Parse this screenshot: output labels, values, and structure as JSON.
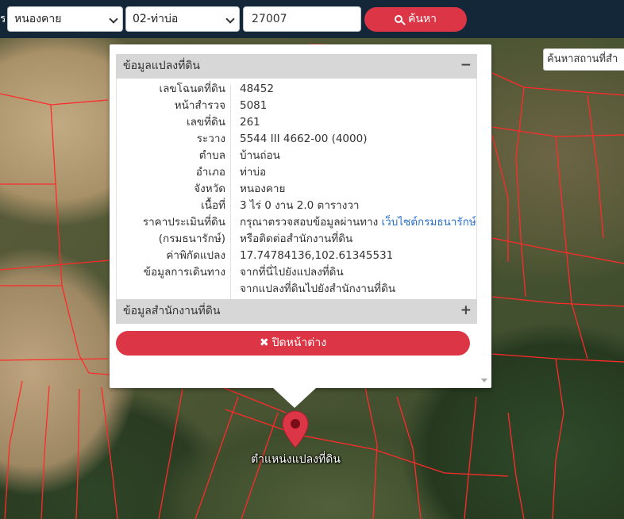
{
  "topbar": {
    "clipped_label": "ร",
    "province_select": "หนองคาย",
    "district_select": "02-ท่าบ่อ",
    "parcel_number_value": "27007",
    "search_button_label": "ค้นหา"
  },
  "map": {
    "land_office_search_placeholder": "ค้นหาสถานที่สำ",
    "marker_label": "ตำแหน่งแปลงที่ดิน",
    "parcel_line_color": "#ff2a2a",
    "marker_color": "#dc3545"
  },
  "popup": {
    "parcel_section_title": "ข้อมูลแปลงที่ดิน",
    "parcel_section_toggle": "−",
    "office_section_title": "ข้อมูลสำนักงานที่ดิน",
    "office_section_toggle": "+",
    "close_button_label": "ปิดหน้าต่าง",
    "rows": [
      {
        "label": "เลขโฉนดที่ดิน",
        "value": "48452"
      },
      {
        "label": "หน้าสำรวจ",
        "value": "5081"
      },
      {
        "label": "เลขที่ดิน",
        "value": "261"
      },
      {
        "label": "ระวาง",
        "value": "5544 III 4662-00 (4000)"
      },
      {
        "label": "ตำบล",
        "value": "บ้านถ่อน"
      },
      {
        "label": "อำเภอ",
        "value": "ท่าบ่อ"
      },
      {
        "label": "จังหวัด",
        "value": "หนองคาย"
      },
      {
        "label": "เนื้อที่",
        "value": "3 ไร่ 0 งาน 2.0 ตารางวา"
      },
      {
        "label": "ราคาประเมินที่ดิน",
        "value": "กรุณาตรวจสอบข้อมูลผ่านทาง ",
        "link": "เว็บไซต์กรมธนารักษ์"
      },
      {
        "label": "(กรมธนารักษ์)",
        "value": "หรือติดต่อสำนักงานที่ดิน"
      },
      {
        "label": "ค่าพิกัดแปลง",
        "link": "17.74784136,102.61345531"
      },
      {
        "label": "ข้อมูลการเดินทาง",
        "link": "จากที่นี่ไปยังแปลงที่ดิน"
      },
      {
        "label": "",
        "link": "จากแปลงที่ดินไปยังสำนักงานที่ดิน"
      }
    ]
  },
  "colors": {
    "topbar_bg": "#142739",
    "accent_red": "#dc3545",
    "link_blue": "#2a6fc9",
    "panel_header_bg": "#d7d7d7"
  }
}
